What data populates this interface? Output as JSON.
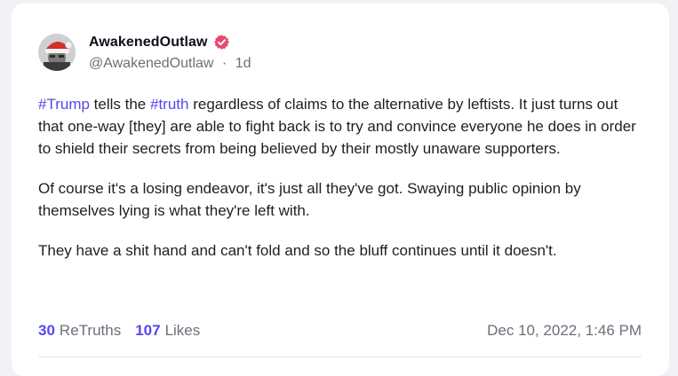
{
  "author": {
    "display_name": "AwakenedOutlaw",
    "handle": "@AwakenedOutlaw",
    "separator": "·",
    "age": "1d",
    "verified_icon": "verified-badge-icon",
    "verified_color": "#e84a6e"
  },
  "post": {
    "paragraphs": [
      [
        {
          "text": "#Trump",
          "hashtag": true
        },
        {
          "text": " tells the ",
          "hashtag": false
        },
        {
          "text": "#truth",
          "hashtag": true
        },
        {
          "text": " regardless of claims to the alternative by leftists.  It just turns out that one-way [they] are able to fight back is to try and convince everyone he does in order to shield their secrets from being believed by their mostly unaware supporters.",
          "hashtag": false
        }
      ],
      [
        {
          "text": "Of course it's a losing endeavor, it's just all they've got.  Swaying public opinion by themselves lying is what they're left with.",
          "hashtag": false
        }
      ],
      [
        {
          "text": "They have a shit hand and can't fold and so the bluff continues until it doesn't.",
          "hashtag": false
        }
      ]
    ]
  },
  "stats": {
    "retruths_count": "30",
    "retruths_label": "ReTruths",
    "likes_count": "107",
    "likes_label": "Likes"
  },
  "timestamp": "Dec 10, 2022, 1:46 PM",
  "colors": {
    "accent": "#5448ee",
    "muted_text": "#6b6f7b",
    "body_text": "#1d1f26"
  }
}
